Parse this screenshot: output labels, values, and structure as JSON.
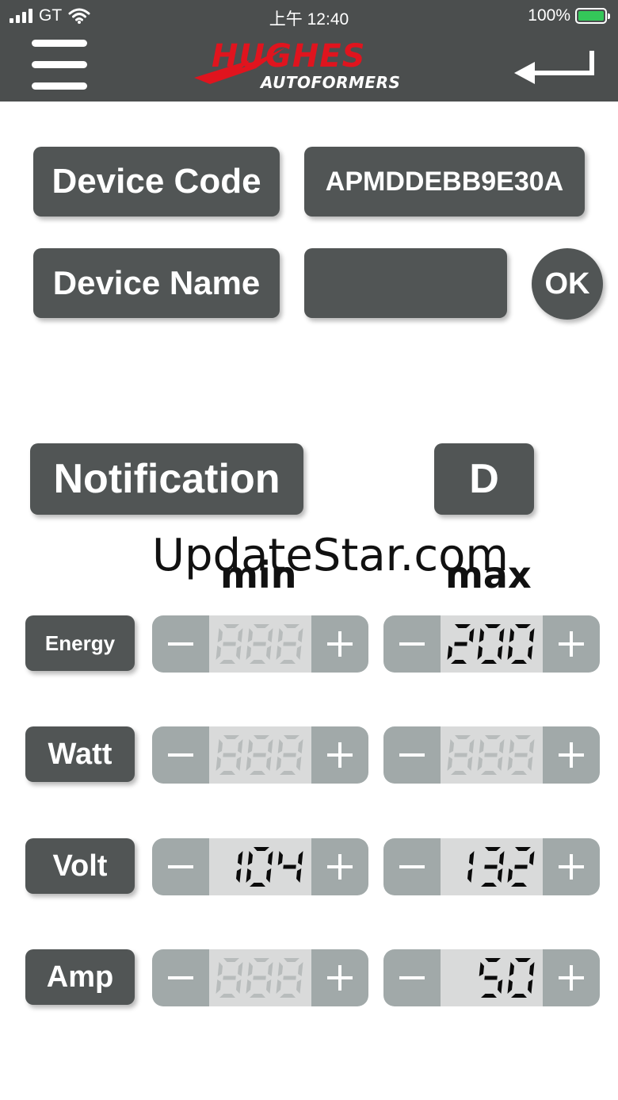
{
  "status_bar": {
    "carrier": "GT",
    "time": "上午 12:40",
    "battery": "100%"
  },
  "header": {
    "logo_brand": "HUGHES",
    "logo_sub": "AUTOFORMERS",
    "menu_icon": "hamburger-menu-icon",
    "back_icon": "return-arrow-icon"
  },
  "device": {
    "code_label": "Device Code",
    "code_value": "APMDDEBB9E30A",
    "name_label": "Device Name",
    "name_value": "",
    "ok_label": "OK"
  },
  "notification": {
    "label": "Notification",
    "mode": "D"
  },
  "watermark": "UpdateStar.com",
  "columns": {
    "min": "min",
    "max": "max"
  },
  "rows": [
    {
      "label": "Energy",
      "min": "",
      "max": "200"
    },
    {
      "label": "Watt",
      "min": "",
      "max": ""
    },
    {
      "label": "Volt",
      "min": "104",
      "max": "132"
    },
    {
      "label": "Amp",
      "min": "",
      "max": "50"
    }
  ],
  "colors": {
    "header_bg": "#4b4e4e",
    "button_bg": "#515555",
    "stepper_btn": "#a1a9a9",
    "display_bg": "#d9dada",
    "logo_red": "#e0141e"
  }
}
